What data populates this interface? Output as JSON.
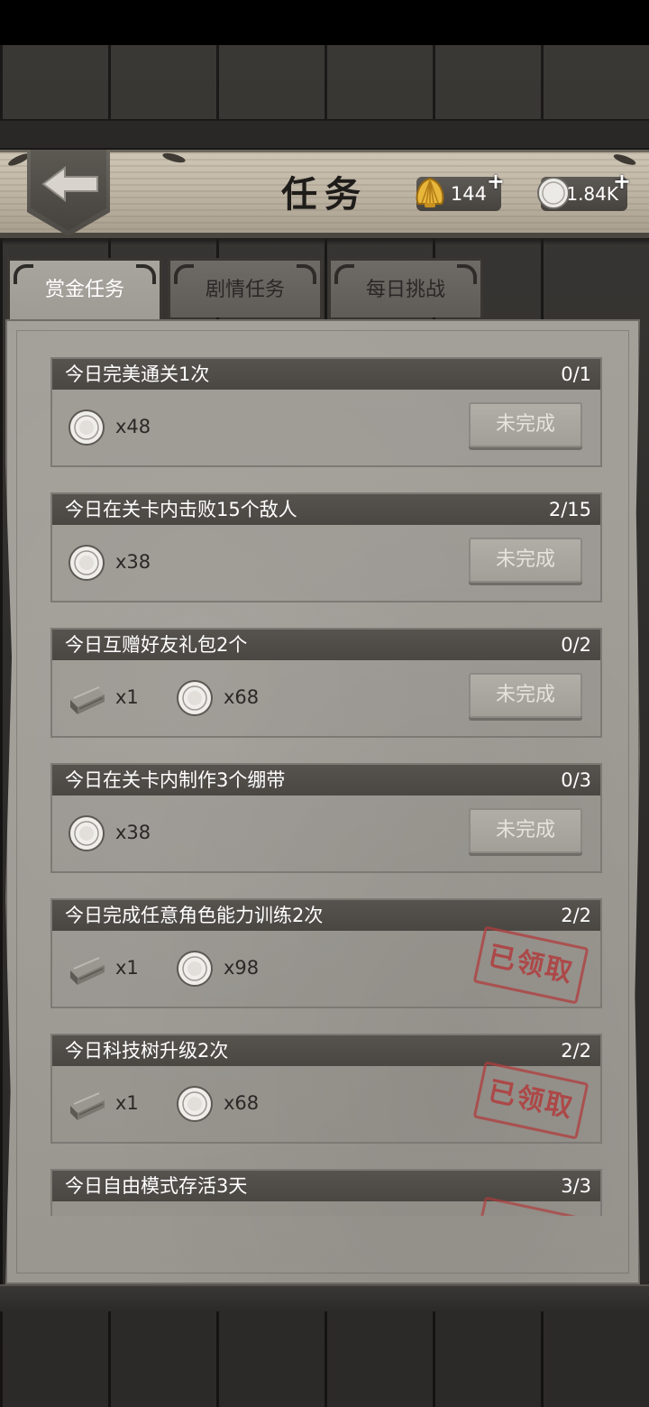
{
  "header": {
    "title": "任务",
    "currencies": [
      {
        "icon": "shell-icon",
        "amount": "144",
        "plus": "+"
      },
      {
        "icon": "coin-icon",
        "amount": "1.84K",
        "plus": "+"
      }
    ]
  },
  "tabs": [
    {
      "label": "赏金任务",
      "active": true
    },
    {
      "label": "剧情任务",
      "active": false
    },
    {
      "label": "每日挑战",
      "active": false
    }
  ],
  "tasks": [
    {
      "title": "今日完美通关1次",
      "progress": "0/1",
      "rewards": [
        {
          "icon": "coin-icon",
          "amount": "x48"
        }
      ],
      "status": "未完成",
      "claimed": false
    },
    {
      "title": "今日在关卡内击败15个敌人",
      "progress": "2/15",
      "rewards": [
        {
          "icon": "coin-icon",
          "amount": "x38"
        }
      ],
      "status": "未完成",
      "claimed": false
    },
    {
      "title": "今日互赠好友礼包2个",
      "progress": "0/2",
      "rewards": [
        {
          "icon": "wood-icon",
          "amount": "x1"
        },
        {
          "icon": "coin-icon",
          "amount": "x68"
        }
      ],
      "status": "未完成",
      "claimed": false
    },
    {
      "title": "今日在关卡内制作3个绷带",
      "progress": "0/3",
      "rewards": [
        {
          "icon": "coin-icon",
          "amount": "x38"
        }
      ],
      "status": "未完成",
      "claimed": false
    },
    {
      "title": "今日完成任意角色能力训练2次",
      "progress": "2/2",
      "rewards": [
        {
          "icon": "wood-icon",
          "amount": "x1"
        },
        {
          "icon": "coin-icon",
          "amount": "x98"
        }
      ],
      "status": "已领取",
      "claimed": true
    },
    {
      "title": "今日科技树升级2次",
      "progress": "2/2",
      "rewards": [
        {
          "icon": "wood-icon",
          "amount": "x1"
        },
        {
          "icon": "coin-icon",
          "amount": "x68"
        }
      ],
      "status": "已领取",
      "claimed": true
    },
    {
      "title": "今日自由模式存活3天",
      "progress": "3/3",
      "rewards": [],
      "status": "",
      "claimed": true
    }
  ],
  "colors": {
    "stamp": "#b03c3c",
    "panel": "#a09c96",
    "header_bar": "#4f4c48"
  }
}
